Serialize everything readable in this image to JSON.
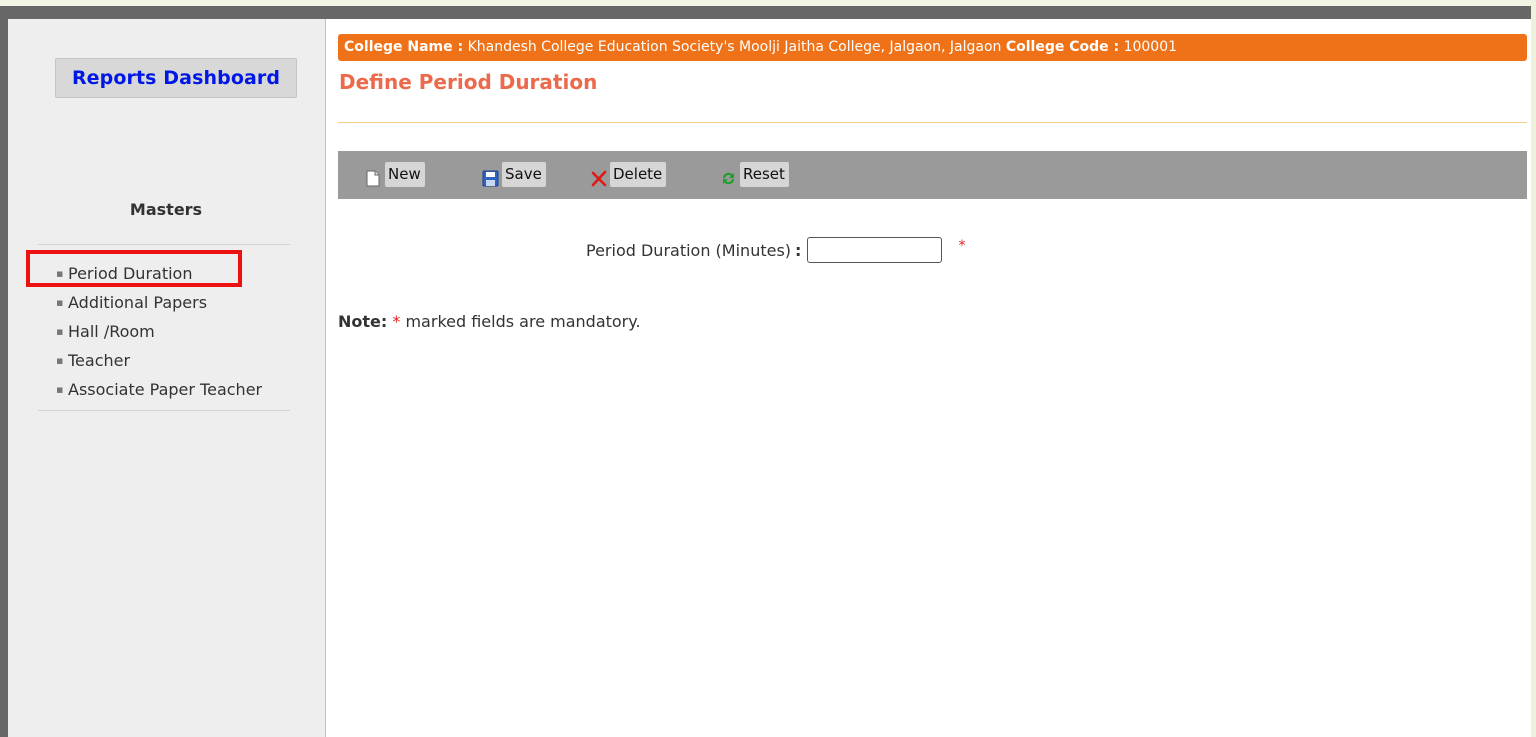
{
  "sidebar": {
    "dashboard_label": "Reports Dashboard",
    "masters_title": "Masters",
    "items": [
      {
        "label": "Period Duration"
      },
      {
        "label": "Additional Papers"
      },
      {
        "label": "Hall /Room"
      },
      {
        "label": "Teacher"
      },
      {
        "label": "Associate Paper Teacher"
      }
    ],
    "bullet": "▪"
  },
  "header": {
    "college_name_label": "College Name :",
    "college_name": "Khandesh College Education Society's Moolji Jaitha College, Jalgaon, Jalgaon",
    "college_code_label": "College Code :",
    "college_code": "100001",
    "page_title": "Define Period Duration"
  },
  "toolbar": {
    "new_label": "New",
    "save_label": "Save",
    "delete_label": "Delete",
    "reset_label": "Reset"
  },
  "form": {
    "period_duration_label": "Period Duration (Minutes)",
    "colon": ":",
    "period_duration_value": "",
    "required_mark": "*"
  },
  "note": {
    "label": "Note:",
    "star": "*",
    "text": "marked fields are mandatory."
  },
  "colors": {
    "college_bar": "#f07218",
    "title": "#ec6a4b",
    "dashboard_text": "#0018e6",
    "highlight": "#ee1111",
    "toolbar": "#9a9a9a"
  }
}
